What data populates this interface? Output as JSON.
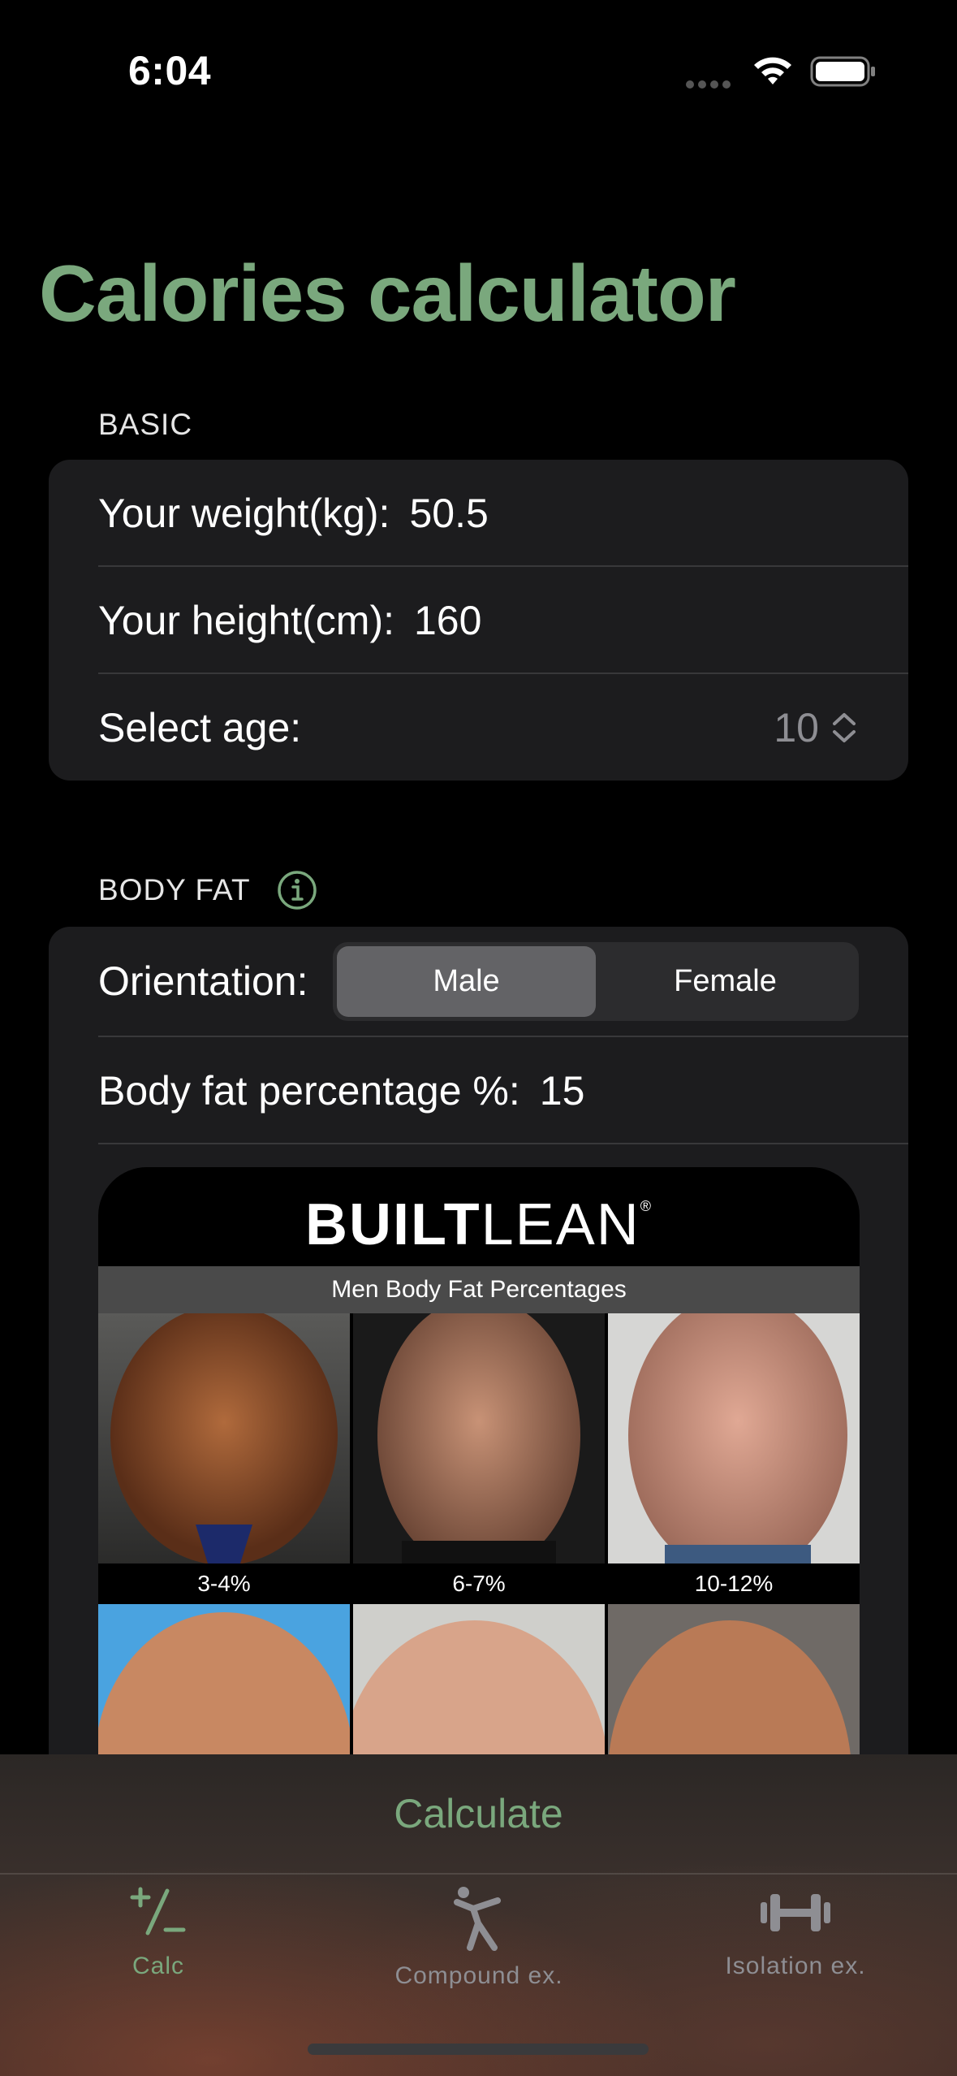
{
  "status_bar": {
    "time": "6:04"
  },
  "title": "Calories calculator",
  "basic": {
    "header": "BASIC",
    "weight_label": "Your weight(kg):",
    "weight_value": "50.5",
    "height_label": "Your height(cm):",
    "height_value": "160",
    "age_label": "Select age:",
    "age_value": "10"
  },
  "body_fat": {
    "header": "BODY FAT",
    "orientation_label": "Orientation:",
    "segments": [
      "Male",
      "Female"
    ],
    "selected_segment": "Male",
    "percentage_label": "Body fat percentage %:",
    "percentage_value": "15",
    "image": {
      "logo_strong": "BUILT",
      "logo_light": "LEAN",
      "logo_mark": "®",
      "caption": "Men Body Fat Percentages",
      "labels": [
        "3-4%",
        "6-7%",
        "10-12%"
      ]
    }
  },
  "calculate_label": "Calculate",
  "tabs": [
    {
      "label": "Calc",
      "icon": "plus-minus-icon",
      "selected": true
    },
    {
      "label": "Compound ex.",
      "icon": "stretching-figure-icon",
      "selected": false
    },
    {
      "label": "Isolation ex.",
      "icon": "dumbbell-icon",
      "selected": false
    }
  ],
  "colors": {
    "accent": "#7aa87d",
    "card": "#1c1c1e",
    "background": "#000000"
  }
}
